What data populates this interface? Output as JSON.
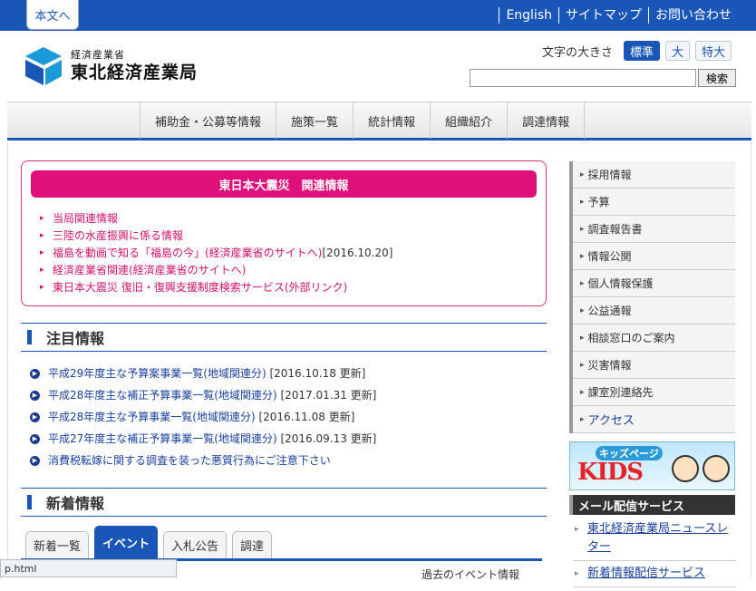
{
  "header": {
    "skip_link": "本文へ",
    "top_links": [
      "English",
      "サイトマップ",
      "お問い合わせ"
    ],
    "logo_sub": "経済産業省",
    "logo_main": "東北経済産業局",
    "font_size_label": "文字の大きさ",
    "font_sizes": [
      "標準",
      "大",
      "特大"
    ],
    "search_placeholder": "",
    "search_button": "検索"
  },
  "global_nav": [
    "補助金・公募等情報",
    "施策一覧",
    "統計情報",
    "組織紹介",
    "調達情報"
  ],
  "disaster": {
    "title": "東日本大震災　関連情報",
    "items": [
      {
        "text": "当局関連情報",
        "date": ""
      },
      {
        "text": "三陸の水産振興に係る情報",
        "date": ""
      },
      {
        "text": "福島を動画で知る「福島の今」(経済産業省のサイトへ)",
        "date": "[2016.10.20]"
      },
      {
        "text": "経済産業省関連(経済産業省のサイトへ)",
        "date": ""
      },
      {
        "text": "東日本大震災 復旧・復興支援制度検索サービス(外部リンク)",
        "date": ""
      }
    ]
  },
  "notice": {
    "title": "注目情報",
    "items": [
      {
        "text": "平成29年度主な予算案事業一覧(地域関連分)",
        "date": "[2016.10.18 更新]"
      },
      {
        "text": "平成28年度主な補正予算事業一覧(地域関連分)",
        "date": "[2017.01.31 更新]"
      },
      {
        "text": "平成28年度主な予算事業一覧(地域関連分)",
        "date": "[2016.11.08 更新]"
      },
      {
        "text": "平成27年度主な補正予算事業一覧(地域関連分)",
        "date": "[2016.09.13 更新]"
      },
      {
        "text": "消費税転嫁に関する調査を装った悪質行為にご注意下さい",
        "date": ""
      }
    ]
  },
  "news": {
    "title": "新着情報",
    "tabs": [
      "新着一覧",
      "イベント",
      "入札公告",
      "調達"
    ],
    "active_tab": "イベント",
    "past_events": "過去のイベント情報"
  },
  "sidebar": {
    "items": [
      "採用情報",
      "予算",
      "調査報告書",
      "情報公開",
      "個人情報保護",
      "公益通報",
      "相談窓口のご案内",
      "災害情報",
      "課室別連絡先",
      "アクセス"
    ]
  },
  "kids_banner": {
    "top": "キッズページ",
    "main": "KIDS"
  },
  "mail_service": {
    "title": "メール配信サービス",
    "items": [
      "東北経済産業局ニュースレター",
      "新着情報配信サービス"
    ]
  },
  "status_bar": "p.html",
  "colors": {
    "brand_blue": "#1a56b8",
    "disaster_pink": "#e0107a"
  }
}
